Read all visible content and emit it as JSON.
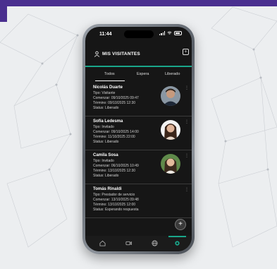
{
  "colors": {
    "accent": "#1aa68a",
    "banner": "#4a2f8f",
    "screen_bg": "#161616"
  },
  "status_bar": {
    "time": "11:44"
  },
  "header": {
    "title": "MIS VISITANTES",
    "user_icon": "user-icon",
    "add_icon": "add-icon"
  },
  "tabs": [
    {
      "label": "Todos",
      "active": true
    },
    {
      "label": "Espera",
      "active": false
    },
    {
      "label": "Liberado",
      "active": false
    }
  ],
  "visitors": [
    {
      "name": "Nicolás Duarte",
      "tipo": "Tipo: Visitante",
      "comienzo": "Comenzar: 09/10/2025 09:47",
      "termino": "Término: 09/10/2025 12:30",
      "status": "Status: Liberado",
      "avatar": "person-photo"
    },
    {
      "name": "Sofía Ledesma",
      "tipo": "Tipo: Invitado",
      "comienzo": "Comenzar: 09/10/2025 14:00",
      "termino": "Término: 11/10/2025 22:00",
      "status": "Status: Liberado",
      "avatar": "person-photo"
    },
    {
      "name": "Camila Sosa",
      "tipo": "Tipo: Invitado",
      "comienzo": "Comenzar: 06/10/2025 10:49",
      "termino": "Término: 13/10/2025 12:30",
      "status": "Status: Liberado",
      "avatar": "person-photo"
    },
    {
      "name": "Tomás Rinaldi",
      "tipo": "Tipo: Prestador de servicio",
      "comienzo": "Comenzar: 13/10/2025 09:48",
      "termino": "Término: 13/10/2025 12:00",
      "status": "Status: Esperando respuesta",
      "avatar": null
    }
  ],
  "fab": {
    "icon": "plus-icon",
    "label": "+"
  },
  "bottom_nav": [
    "home-icon",
    "video-icon",
    "globe-icon",
    "visitors-icon"
  ]
}
